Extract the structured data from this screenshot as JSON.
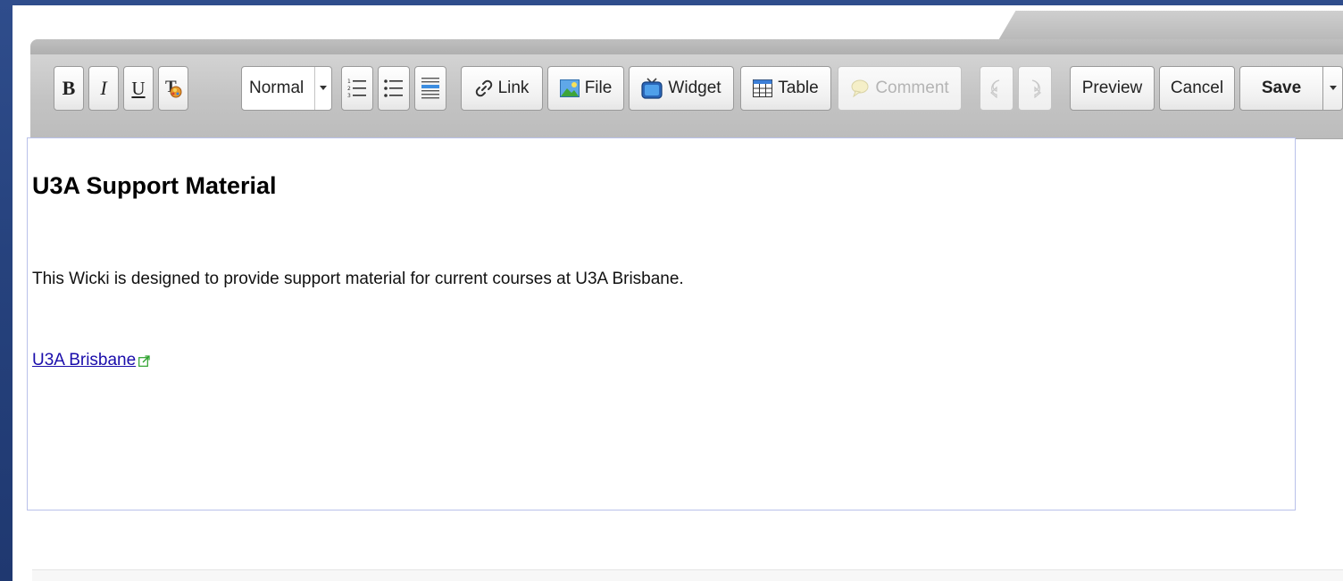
{
  "toolbar": {
    "bold_label": "B",
    "italic_label": "I",
    "underline_label": "U",
    "style_select_value": "Normal",
    "link_label": "Link",
    "file_label": "File",
    "widget_label": "Widget",
    "table_label": "Table",
    "comment_label": "Comment",
    "preview_label": "Preview",
    "cancel_label": "Cancel",
    "save_label": "Save"
  },
  "content": {
    "heading": "U3A Support Material",
    "paragraph": "This Wicki is designed to provide support material for current courses at U3A Brisbane.",
    "link_text": "U3A Brisbane"
  },
  "colors": {
    "background": "#2a4683",
    "link": "#1a0dab",
    "external_link_icon": "#2aa02a",
    "editor_border": "#b9c1ea"
  }
}
